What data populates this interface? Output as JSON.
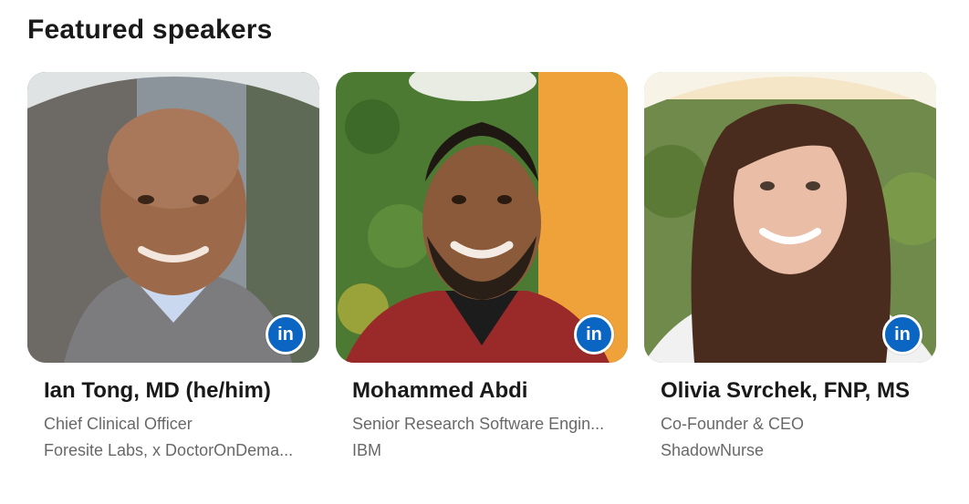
{
  "section": {
    "title": "Featured speakers"
  },
  "speakers": [
    {
      "name": "Ian Tong, MD (he/him)",
      "role": "Chief Clinical Officer",
      "company": "Foresite Labs, x DoctorOnDema...",
      "badge_icon": "linkedin-icon",
      "badge_text": "in"
    },
    {
      "name": "Mohammed Abdi",
      "role": "Senior Research Software Engin...",
      "company": "IBM",
      "badge_icon": "linkedin-icon",
      "badge_text": "in"
    },
    {
      "name": "Olivia Svrchek, FNP, MS",
      "role": "Co-Founder & CEO",
      "company": "ShadowNurse",
      "badge_icon": "linkedin-icon",
      "badge_text": "in"
    }
  ],
  "colors": {
    "linkedin_blue": "#0a66c2"
  }
}
